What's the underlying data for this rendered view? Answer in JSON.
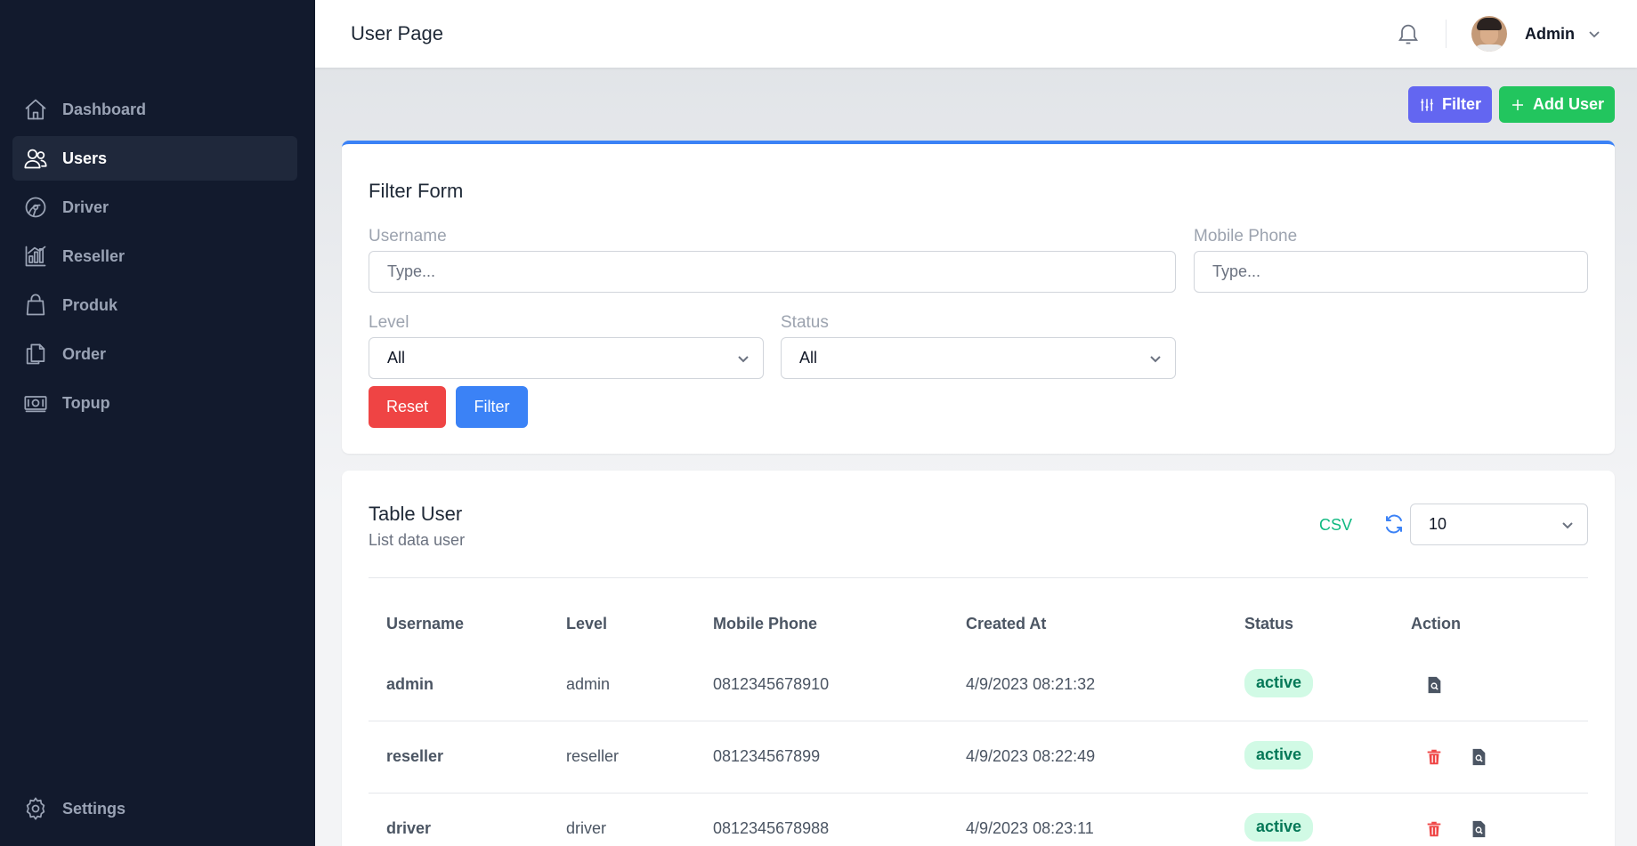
{
  "sidebar": {
    "items": [
      {
        "label": "Dashboard",
        "icon": "home-icon",
        "active": false
      },
      {
        "label": "Users",
        "icon": "users-icon",
        "active": true
      },
      {
        "label": "Driver",
        "icon": "driver-icon",
        "active": false
      },
      {
        "label": "Reseller",
        "icon": "reseller-icon",
        "active": false
      },
      {
        "label": "Produk",
        "icon": "shopping-bag-icon",
        "active": false
      },
      {
        "label": "Order",
        "icon": "documents-icon",
        "active": false
      },
      {
        "label": "Topup",
        "icon": "cash-icon",
        "active": false
      }
    ],
    "settings_label": "Settings"
  },
  "header": {
    "title": "User Page",
    "user_name": "Admin"
  },
  "actions": {
    "filter_label": "Filter",
    "add_user_label": "Add User"
  },
  "filter_form": {
    "title": "Filter Form",
    "username_label": "Username",
    "username_placeholder": "Type...",
    "mobile_label": "Mobile Phone",
    "mobile_placeholder": "Type...",
    "level_label": "Level",
    "level_value": "All",
    "status_label": "Status",
    "status_value": "All",
    "reset_label": "Reset",
    "filter_label": "Filter"
  },
  "table": {
    "title": "Table User",
    "subtitle": "List data user",
    "csv_label": "CSV",
    "page_size": "10",
    "columns": [
      "Username",
      "Level",
      "Mobile Phone",
      "Created At",
      "Status",
      "Action"
    ],
    "rows": [
      {
        "username": "admin",
        "level": "admin",
        "phone": "0812345678910",
        "created": "4/9/2023 08:21:32",
        "status": "active"
      },
      {
        "username": "reseller",
        "level": "reseller",
        "phone": "081234567899",
        "created": "4/9/2023 08:22:49",
        "status": "active"
      },
      {
        "username": "driver",
        "level": "driver",
        "phone": "0812345678988",
        "created": "4/9/2023 08:23:11",
        "status": "active"
      }
    ]
  },
  "colors": {
    "sidebar_bg": "#121a2d",
    "primary": "#3b82f6",
    "indigo": "#6366f1",
    "success": "#22c55e",
    "danger": "#ef4444"
  }
}
